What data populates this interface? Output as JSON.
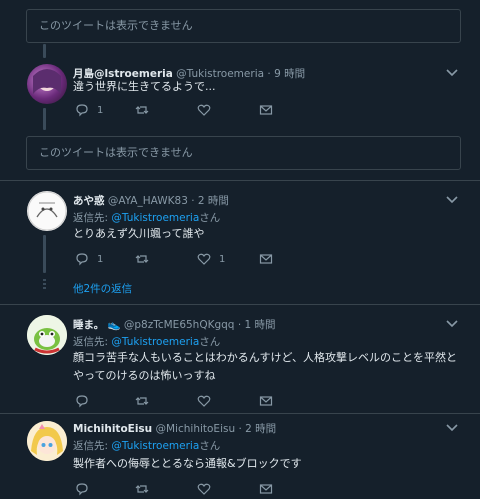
{
  "unavailable_text": "このツイートは表示できません",
  "reply_to_label": "返信先:",
  "reply_suffix": "さん",
  "more_replies": "他2件の返信",
  "tweets": [
    {
      "name": "月島@lstroemeria",
      "handle": "@Tukistroemeria",
      "time": "· 9 時間",
      "text": "違う世界に生きてるようで...",
      "reply_count": "1",
      "like_count": ""
    },
    {
      "name": "あや惑",
      "handle": "@AYA_HAWK83",
      "time": "· 2 時間",
      "reply_to": "@Tukistroemeria",
      "text": "とりあえず久川颯って誰や",
      "reply_count": "1",
      "like_count": "1"
    },
    {
      "name": "睡ま。",
      "name_emoji": "👟",
      "handle": "@p8zTcME65hQKgqq",
      "time": "· 1 時間",
      "reply_to": "@Tukistroemeria",
      "text_line1": "顔コラ苦手な人もいることはわかるんすけど、人格攻撃レベルのことを平然と",
      "text_line2": "やってのけるのは怖いっすね",
      "reply_count": "",
      "like_count": ""
    },
    {
      "name": "MichihitoEisu",
      "handle": "@MichihitoEisu",
      "time": "· 2 時間",
      "reply_to": "@Tukistroemeria",
      "text": "製作者への侮辱ととるなら通報&ブロックです",
      "reply_count": "",
      "like_count": ""
    }
  ],
  "colors": {
    "background": "#15202b",
    "border": "#38444d",
    "secondary_text": "#8899a6",
    "link": "#1da1f2"
  },
  "icons": [
    "reply-icon",
    "retweet-icon",
    "like-icon",
    "dm-icon",
    "chevron-down-icon"
  ]
}
